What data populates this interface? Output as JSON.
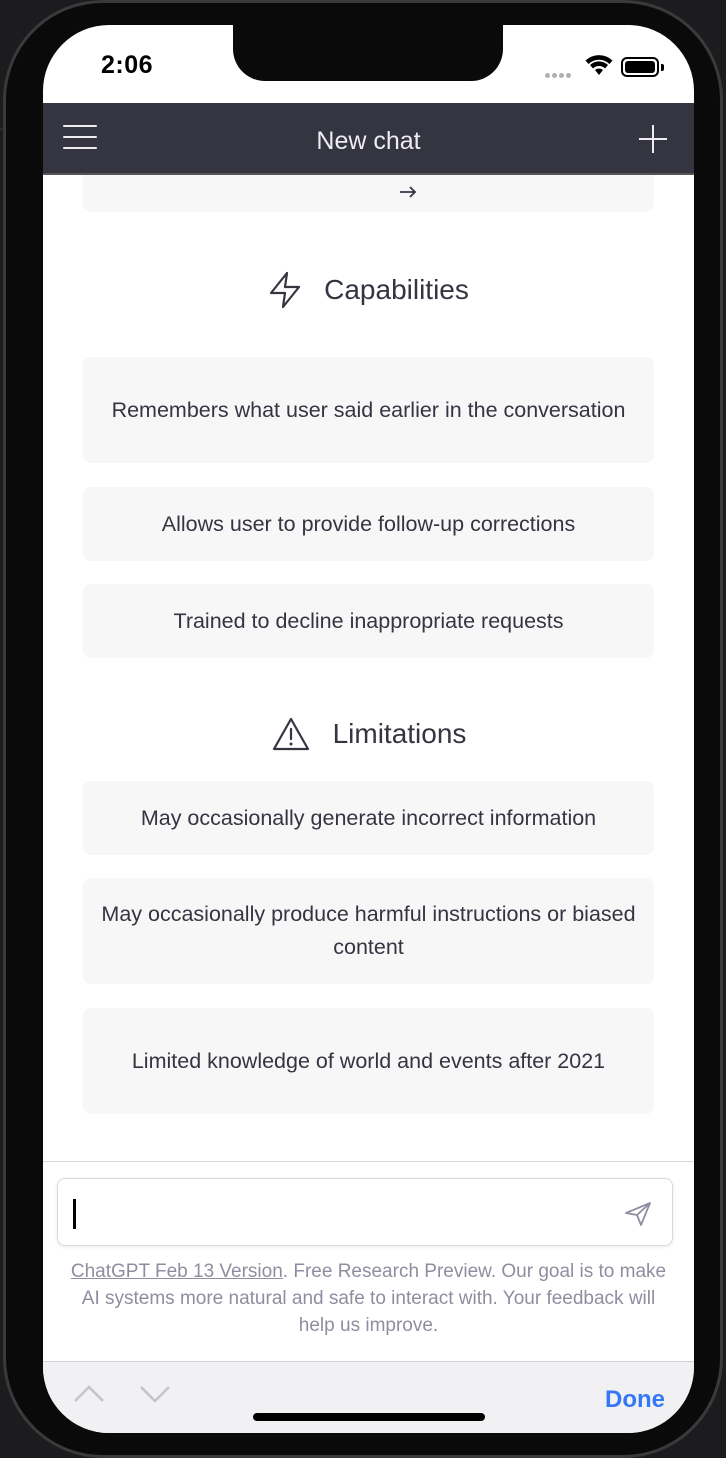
{
  "status_bar": {
    "time": "2:06"
  },
  "navbar": {
    "title": "New chat"
  },
  "capabilities": {
    "heading": "Capabilities",
    "items": [
      "Remembers what user said earlier in the conversation",
      "Allows user to provide follow-up corrections",
      "Trained to decline inappropriate requests"
    ]
  },
  "limitations": {
    "heading": "Limitations",
    "items": [
      "May occasionally generate incorrect information",
      "May occasionally produce harmful instructions or biased content",
      "Limited knowledge of world and events after 2021"
    ]
  },
  "input": {
    "value": ""
  },
  "footer": {
    "version_link": "ChatGPT Feb 13 Version",
    "text": ". Free Research Preview. Our goal is to make AI systems more natural and safe to interact with. Your feedback will help us improve."
  },
  "keyboard_bar": {
    "done_label": "Done"
  },
  "colors": {
    "navbar_bg": "#343541",
    "card_bg": "#f7f7f8",
    "text": "#343541",
    "accent": "#3478f6"
  }
}
